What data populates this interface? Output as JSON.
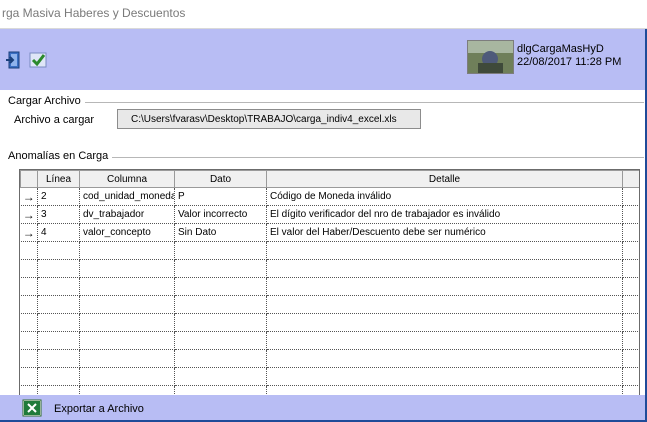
{
  "window": {
    "title": "rga Masiva Haberes y Descuentos"
  },
  "toolbar": {
    "exit_icon": "exit-door-icon",
    "confirm_icon": "checkmark-icon",
    "form_name": "dlgCargaMasHyD",
    "timestamp": "22/08/2017 11:28 PM"
  },
  "cargar": {
    "group_title": "Cargar Archivo",
    "file_label": "Archivo a cargar",
    "file_path": "C:\\Users\\fvarasv\\Desktop\\TRABAJO\\carga_indiv4_excel.xls"
  },
  "anomalias": {
    "group_title": "Anomalías en Carga",
    "columns": [
      "Línea",
      "Columna",
      "Dato",
      "Detalle"
    ],
    "rows": [
      {
        "linea": "2",
        "columna": "cod_unidad_moneda",
        "dato": "P",
        "detalle": "Código de Moneda inválido"
      },
      {
        "linea": "3",
        "columna": "dv_trabajador",
        "dato": "Valor incorrecto",
        "detalle": "El dígito verificador del nro de trabajador es inválido"
      },
      {
        "linea": "4",
        "columna": "valor_concepto",
        "dato": "Sin Dato",
        "detalle": "El valor del Haber/Descuento debe ser numérico"
      }
    ],
    "row_indicator": "→"
  },
  "export": {
    "label": "Exportar a Archivo",
    "icon": "excel-icon"
  },
  "colors": {
    "toolbar_bg": "#b8bdf4",
    "frame_border": "#1f4b99"
  }
}
